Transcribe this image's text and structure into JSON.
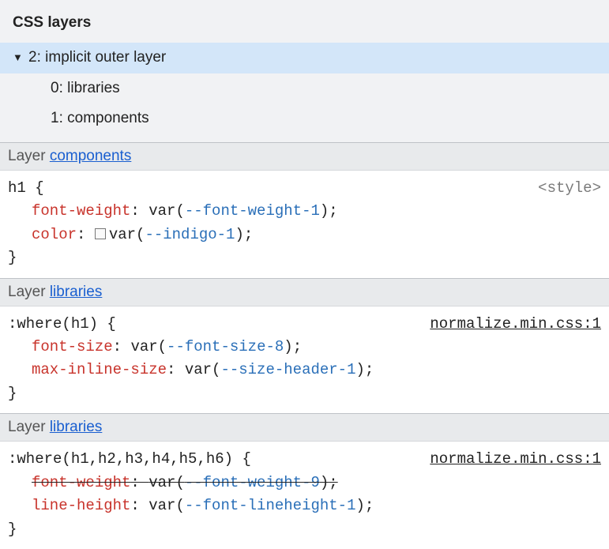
{
  "title": "CSS layers",
  "tree": {
    "root": {
      "index": "2",
      "label": "implicit outer layer"
    },
    "children": [
      {
        "index": "0",
        "label": "libraries"
      },
      {
        "index": "1",
        "label": "components"
      }
    ]
  },
  "layers": [
    {
      "header_prefix": "Layer ",
      "name": "components",
      "selector": "h1",
      "source_kind": "tag",
      "source": "<style>",
      "decls": [
        {
          "prop": "font-weight",
          "var": "--font-weight-1",
          "swatch": false,
          "strike": false
        },
        {
          "prop": "color",
          "var": "--indigo-1",
          "swatch": true,
          "strike": false
        }
      ]
    },
    {
      "header_prefix": "Layer ",
      "name": "libraries",
      "selector": ":where(h1)",
      "source_kind": "link",
      "source": "normalize.min.css:1",
      "decls": [
        {
          "prop": "font-size",
          "var": "--font-size-8",
          "swatch": false,
          "strike": false
        },
        {
          "prop": "max-inline-size",
          "var": "--size-header-1",
          "swatch": false,
          "strike": false
        }
      ]
    },
    {
      "header_prefix": "Layer ",
      "name": "libraries",
      "selector": ":where(h1,h2,h3,h4,h5,h6)",
      "source_kind": "link",
      "source": "normalize.min.css:1",
      "decls": [
        {
          "prop": "font-weight",
          "var": "--font-weight-9",
          "swatch": false,
          "strike": true
        },
        {
          "prop": "line-height",
          "var": "--font-lineheight-1",
          "swatch": false,
          "strike": false
        }
      ]
    }
  ]
}
